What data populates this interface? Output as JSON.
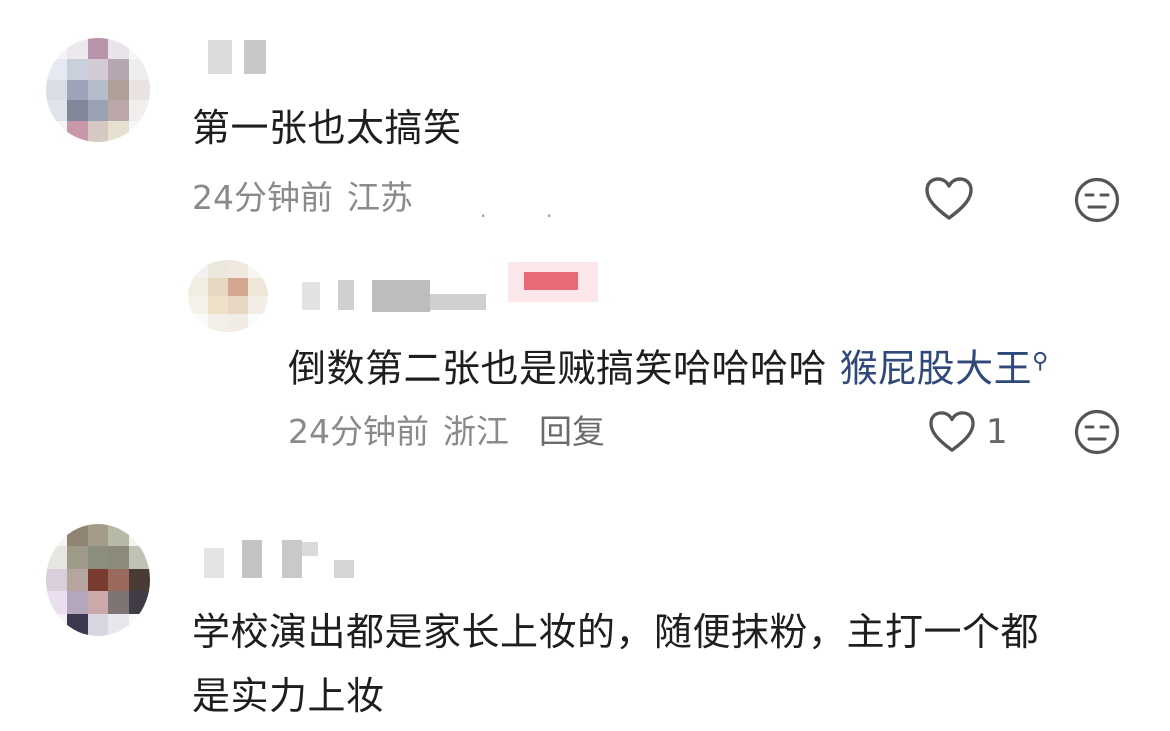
{
  "comments": [
    {
      "text": "第一张也太搞笑",
      "time": "24分钟前",
      "location": "江苏",
      "like_count": "",
      "replies": [
        {
          "text": "倒数第二张也是贼搞笑哈哈哈哈",
          "mention": "猴屁股大王",
          "time": "24分钟前",
          "location": "浙江",
          "reply_label": "回复",
          "like_count": "1"
        }
      ]
    },
    {
      "text_line1": "学校演出都是家长上妆的，随便抹粉，主打一个都",
      "text_line2": "是实力上妆"
    }
  ],
  "icons": {
    "like": "heart-outline-icon",
    "dislike": "neutral-face-icon",
    "mention_marker": "search-icon"
  },
  "colors": {
    "text": "#1e1e1e",
    "meta": "#8a8a8a",
    "mention": "#2f4a7a",
    "icon": "#555555"
  }
}
